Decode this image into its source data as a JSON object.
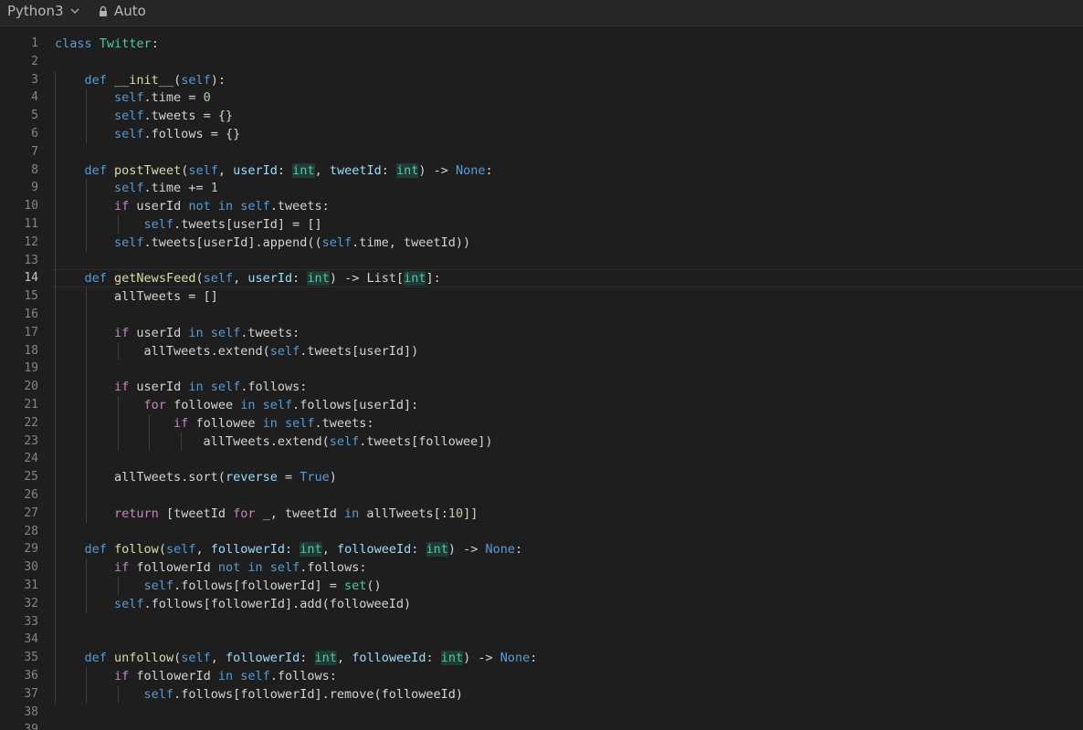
{
  "toolbar": {
    "language": "Python3",
    "mode": "Auto"
  },
  "editor": {
    "active_line": 14,
    "lines": [
      [
        [
          "kd",
          "class"
        ],
        [
          "t",
          " "
        ],
        [
          "cl",
          "Twitter"
        ],
        [
          "t",
          ":"
        ]
      ],
      [],
      [
        [
          "t",
          "    "
        ],
        [
          "kd",
          "def"
        ],
        [
          "t",
          " "
        ],
        [
          "fn",
          "__init__"
        ],
        [
          "t",
          "("
        ],
        [
          "sf",
          "self"
        ],
        [
          "t",
          "):"
        ]
      ],
      [
        [
          "t",
          "        "
        ],
        [
          "sf",
          "self"
        ],
        [
          "t",
          ".time = "
        ],
        [
          "nm",
          "0"
        ]
      ],
      [
        [
          "t",
          "        "
        ],
        [
          "sf",
          "self"
        ],
        [
          "t",
          ".tweets = {}"
        ]
      ],
      [
        [
          "t",
          "        "
        ],
        [
          "sf",
          "self"
        ],
        [
          "t",
          ".follows = {}"
        ]
      ],
      [],
      [
        [
          "t",
          "    "
        ],
        [
          "kd",
          "def"
        ],
        [
          "t",
          " "
        ],
        [
          "fn",
          "postTweet"
        ],
        [
          "t",
          "("
        ],
        [
          "sf",
          "self"
        ],
        [
          "t",
          ", "
        ],
        [
          "pa",
          "userId"
        ],
        [
          "t",
          ": "
        ],
        [
          "ty",
          "int"
        ],
        [
          "t",
          ", "
        ],
        [
          "pa",
          "tweetId"
        ],
        [
          "t",
          ": "
        ],
        [
          "ty",
          "int"
        ],
        [
          "t",
          ") -> "
        ],
        [
          "kd",
          "None"
        ],
        [
          "t",
          ":"
        ]
      ],
      [
        [
          "t",
          "        "
        ],
        [
          "sf",
          "self"
        ],
        [
          "t",
          ".time += "
        ],
        [
          "nm",
          "1"
        ]
      ],
      [
        [
          "t",
          "        "
        ],
        [
          "k",
          "if"
        ],
        [
          "t",
          " userId "
        ],
        [
          "kd",
          "not"
        ],
        [
          "t",
          " "
        ],
        [
          "kd",
          "in"
        ],
        [
          "t",
          " "
        ],
        [
          "sf",
          "self"
        ],
        [
          "t",
          ".tweets:"
        ]
      ],
      [
        [
          "t",
          "            "
        ],
        [
          "sf",
          "self"
        ],
        [
          "t",
          ".tweets[userId] = []"
        ]
      ],
      [
        [
          "t",
          "        "
        ],
        [
          "sf",
          "self"
        ],
        [
          "t",
          ".tweets[userId].append(("
        ],
        [
          "sf",
          "self"
        ],
        [
          "t",
          ".time, tweetId))"
        ]
      ],
      [],
      [
        [
          "t",
          "    "
        ],
        [
          "kd",
          "def"
        ],
        [
          "t",
          " "
        ],
        [
          "fn",
          "getNewsFeed"
        ],
        [
          "t",
          "("
        ],
        [
          "sf",
          "self"
        ],
        [
          "t",
          ", "
        ],
        [
          "pa",
          "userId"
        ],
        [
          "t",
          ": "
        ],
        [
          "ty",
          "int"
        ],
        [
          "t",
          ") -> List["
        ],
        [
          "ty",
          "int"
        ],
        [
          "t",
          "]:"
        ]
      ],
      [
        [
          "t",
          "        allTweets = []"
        ]
      ],
      [],
      [
        [
          "t",
          "        "
        ],
        [
          "k",
          "if"
        ],
        [
          "t",
          " userId "
        ],
        [
          "kd",
          "in"
        ],
        [
          "t",
          " "
        ],
        [
          "sf",
          "self"
        ],
        [
          "t",
          ".tweets:"
        ]
      ],
      [
        [
          "t",
          "            allTweets.extend("
        ],
        [
          "sf",
          "self"
        ],
        [
          "t",
          ".tweets[userId])"
        ]
      ],
      [],
      [
        [
          "t",
          "        "
        ],
        [
          "k",
          "if"
        ],
        [
          "t",
          " userId "
        ],
        [
          "kd",
          "in"
        ],
        [
          "t",
          " "
        ],
        [
          "sf",
          "self"
        ],
        [
          "t",
          ".follows:"
        ]
      ],
      [
        [
          "t",
          "            "
        ],
        [
          "k",
          "for"
        ],
        [
          "t",
          " followee "
        ],
        [
          "kd",
          "in"
        ],
        [
          "t",
          " "
        ],
        [
          "sf",
          "self"
        ],
        [
          "t",
          ".follows[userId]:"
        ]
      ],
      [
        [
          "t",
          "                "
        ],
        [
          "k",
          "if"
        ],
        [
          "t",
          " followee "
        ],
        [
          "kd",
          "in"
        ],
        [
          "t",
          " "
        ],
        [
          "sf",
          "self"
        ],
        [
          "t",
          ".tweets:"
        ]
      ],
      [
        [
          "t",
          "                    allTweets.extend("
        ],
        [
          "sf",
          "self"
        ],
        [
          "t",
          ".tweets[followee])"
        ]
      ],
      [],
      [
        [
          "t",
          "        allTweets.sort("
        ],
        [
          "pa",
          "reverse"
        ],
        [
          "t",
          " = "
        ],
        [
          "kd",
          "True"
        ],
        [
          "t",
          ")"
        ]
      ],
      [],
      [
        [
          "t",
          "        "
        ],
        [
          "k",
          "return"
        ],
        [
          "t",
          " [tweetId "
        ],
        [
          "k",
          "for"
        ],
        [
          "t",
          " _, tweetId "
        ],
        [
          "kd",
          "in"
        ],
        [
          "t",
          " allTweets[:"
        ],
        [
          "nm",
          "10"
        ],
        [
          "t",
          "]]"
        ]
      ],
      [],
      [
        [
          "t",
          "    "
        ],
        [
          "kd",
          "def"
        ],
        [
          "t",
          " "
        ],
        [
          "fn",
          "follow"
        ],
        [
          "t",
          "("
        ],
        [
          "sf",
          "self"
        ],
        [
          "t",
          ", "
        ],
        [
          "pa",
          "followerId"
        ],
        [
          "t",
          ": "
        ],
        [
          "ty",
          "int"
        ],
        [
          "t",
          ", "
        ],
        [
          "pa",
          "followeeId"
        ],
        [
          "t",
          ": "
        ],
        [
          "ty",
          "int"
        ],
        [
          "t",
          ") -> "
        ],
        [
          "kd",
          "None"
        ],
        [
          "t",
          ":"
        ]
      ],
      [
        [
          "t",
          "        "
        ],
        [
          "k",
          "if"
        ],
        [
          "t",
          " followerId "
        ],
        [
          "kd",
          "not"
        ],
        [
          "t",
          " "
        ],
        [
          "kd",
          "in"
        ],
        [
          "t",
          " "
        ],
        [
          "sf",
          "self"
        ],
        [
          "t",
          ".follows:"
        ]
      ],
      [
        [
          "t",
          "            "
        ],
        [
          "sf",
          "self"
        ],
        [
          "t",
          ".follows[followerId] = "
        ],
        [
          "cl",
          "set"
        ],
        [
          "t",
          "()"
        ]
      ],
      [
        [
          "t",
          "        "
        ],
        [
          "sf",
          "self"
        ],
        [
          "t",
          ".follows[followerId].add(followeeId)"
        ]
      ],
      [],
      [],
      [
        [
          "t",
          "    "
        ],
        [
          "kd",
          "def"
        ],
        [
          "t",
          " "
        ],
        [
          "fn",
          "unfollow"
        ],
        [
          "t",
          "("
        ],
        [
          "sf",
          "self"
        ],
        [
          "t",
          ", "
        ],
        [
          "pa",
          "followerId"
        ],
        [
          "t",
          ": "
        ],
        [
          "ty",
          "int"
        ],
        [
          "t",
          ", "
        ],
        [
          "pa",
          "followeeId"
        ],
        [
          "t",
          ": "
        ],
        [
          "ty",
          "int"
        ],
        [
          "t",
          ") -> "
        ],
        [
          "kd",
          "None"
        ],
        [
          "t",
          ":"
        ]
      ],
      [
        [
          "t",
          "        "
        ],
        [
          "k",
          "if"
        ],
        [
          "t",
          " followerId "
        ],
        [
          "kd",
          "in"
        ],
        [
          "t",
          " "
        ],
        [
          "sf",
          "self"
        ],
        [
          "t",
          ".follows:"
        ]
      ],
      [
        [
          "t",
          "            "
        ],
        [
          "sf",
          "self"
        ],
        [
          "t",
          ".follows[followerId].remove(followeeId)"
        ]
      ],
      [],
      []
    ]
  }
}
